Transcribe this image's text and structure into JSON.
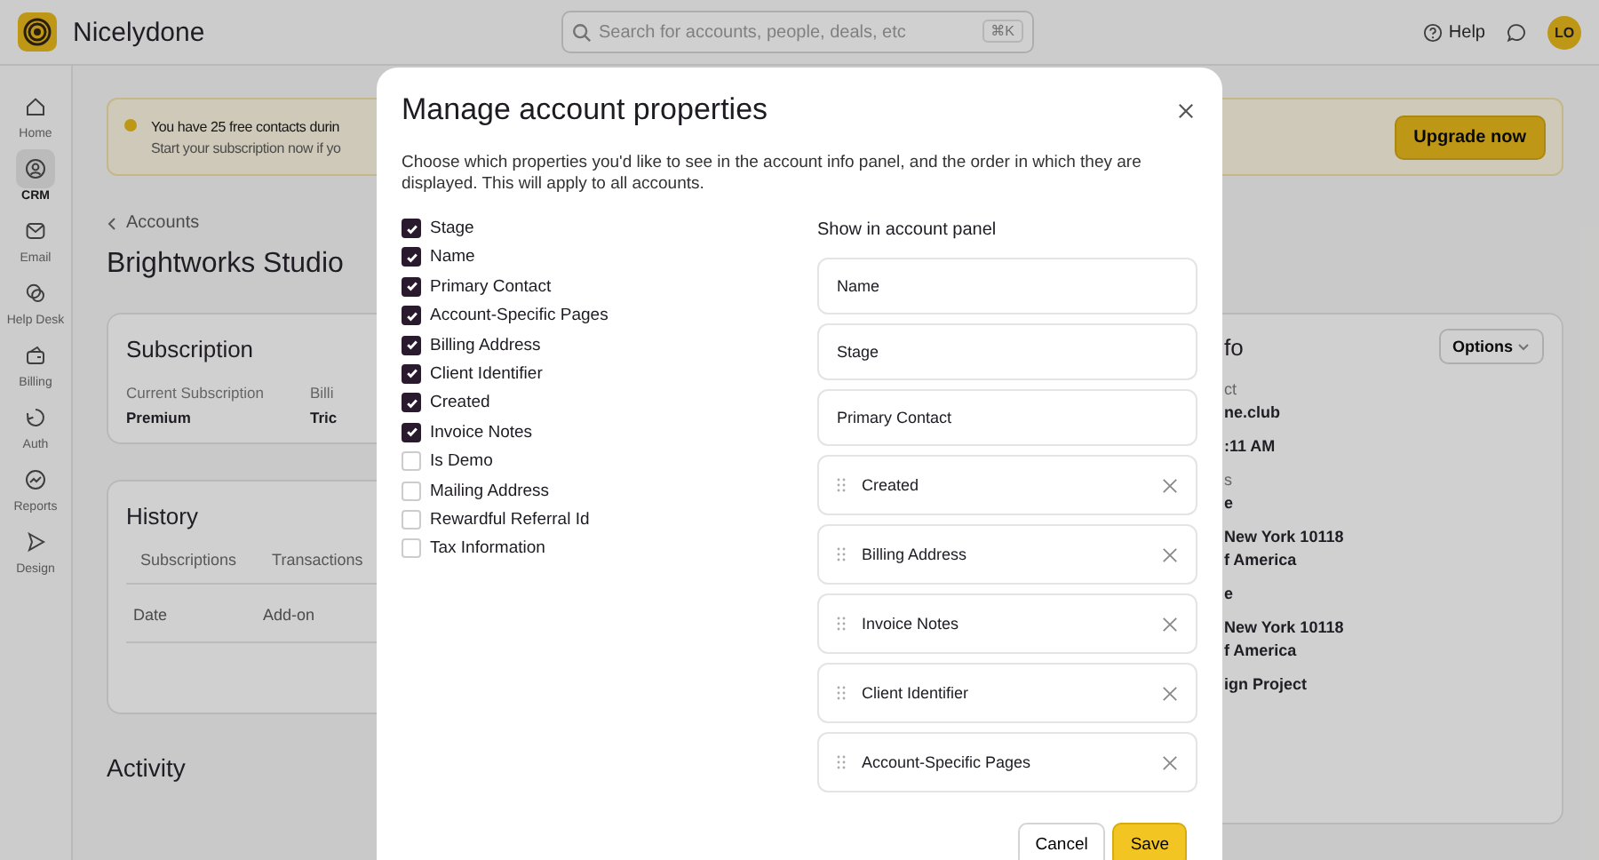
{
  "app": {
    "name": "Nicelydone"
  },
  "search": {
    "placeholder": "Search for accounts, people, deals, etc",
    "shortcut": "⌘K"
  },
  "header": {
    "help": "Help",
    "avatar": "LO"
  },
  "nav": [
    {
      "label": "Home",
      "selected": false
    },
    {
      "label": "CRM",
      "selected": true
    },
    {
      "label": "Email",
      "selected": false
    },
    {
      "label": "Help Desk",
      "selected": false
    },
    {
      "label": "Billing",
      "selected": false
    },
    {
      "label": "Auth",
      "selected": false
    },
    {
      "label": "Reports",
      "selected": false
    },
    {
      "label": "Design",
      "selected": false
    }
  ],
  "banner": {
    "title": "You have 25 free contacts durin",
    "text": "Start your subscription now if yo",
    "button": "Upgrade now"
  },
  "breadcrumb": "Accounts",
  "account_name": "Brightworks Studio",
  "subscription": {
    "title": "Subscription",
    "fields": [
      {
        "label": "Current Subscription",
        "value": "Premium"
      },
      {
        "label": "Billi",
        "value": "Tric"
      }
    ]
  },
  "history": {
    "title": "History",
    "tabs": [
      "Subscriptions",
      "Transactions"
    ],
    "columns": [
      "Date",
      "Add-on"
    ]
  },
  "activity": {
    "title": "Activity"
  },
  "info_card": {
    "title": "fo",
    "options": "Options",
    "groups": [
      {
        "label": "ct",
        "lines": [
          "ne.club"
        ]
      },
      {
        "lines": [
          ":11 AM"
        ]
      },
      {
        "label": "s",
        "lines": [
          "e"
        ]
      },
      {
        "lines": [
          "New York  10118",
          "f America"
        ]
      },
      {
        "lines": [
          "e"
        ]
      },
      {
        "lines": [
          "New York  10118",
          "f America"
        ]
      },
      {
        "lines": [
          "ign Project"
        ]
      }
    ]
  },
  "modal": {
    "title": "Manage account properties",
    "description": "Choose which properties you'd like to see in the account info panel, and the order in which they are displayed. This will apply to all accounts.",
    "properties": [
      {
        "label": "Stage",
        "checked": true
      },
      {
        "label": "Name",
        "checked": true
      },
      {
        "label": "Primary Contact",
        "checked": true
      },
      {
        "label": "Account-Specific Pages",
        "checked": true
      },
      {
        "label": "Billing Address",
        "checked": true
      },
      {
        "label": "Client Identifier",
        "checked": true
      },
      {
        "label": "Created",
        "checked": true
      },
      {
        "label": "Invoice Notes",
        "checked": true
      },
      {
        "label": "Is Demo",
        "checked": false
      },
      {
        "label": "Mailing Address",
        "checked": false
      },
      {
        "label": "Rewardful Referral Id",
        "checked": false
      },
      {
        "label": "Tax Information",
        "checked": false
      }
    ],
    "panel_title": "Show in account panel",
    "panel_items": [
      {
        "label": "Name",
        "kind": "fixed"
      },
      {
        "label": "Stage",
        "kind": "fixed"
      },
      {
        "label": "Primary Contact",
        "kind": "fixed"
      },
      {
        "label": "Created",
        "kind": "movable"
      },
      {
        "label": "Billing Address",
        "kind": "movable"
      },
      {
        "label": "Invoice Notes",
        "kind": "movable"
      },
      {
        "label": "Client Identifier",
        "kind": "movable"
      },
      {
        "label": "Account-Specific Pages",
        "kind": "movable"
      }
    ],
    "cancel": "Cancel",
    "save": "Save"
  }
}
